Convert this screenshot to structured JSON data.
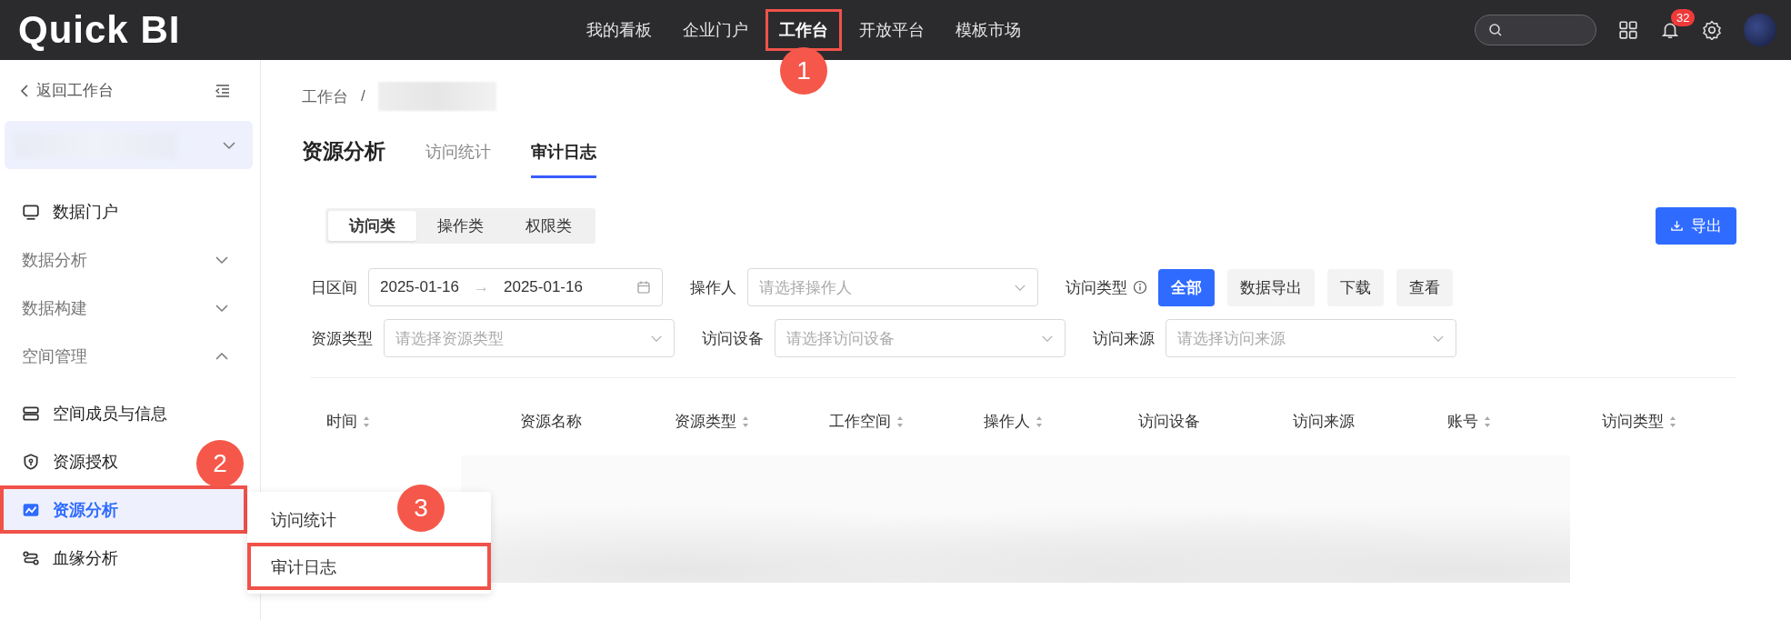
{
  "topbar": {
    "logo": "Quick BI",
    "nav": [
      {
        "label": "我的看板",
        "selected": false,
        "highlighted": false
      },
      {
        "label": "企业门户",
        "selected": false,
        "highlighted": false
      },
      {
        "label": "工作台",
        "selected": true,
        "highlighted": true,
        "callout": "1"
      },
      {
        "label": "开放平台",
        "selected": false,
        "highlighted": false
      },
      {
        "label": "模板市场",
        "selected": false,
        "highlighted": false
      }
    ],
    "notification_count": "32"
  },
  "sidebar": {
    "back": "返回工作台",
    "items": [
      {
        "kind": "link",
        "label": "数据门户",
        "selected": false
      },
      {
        "kind": "group",
        "label": "数据分析",
        "expanded": false
      },
      {
        "kind": "group",
        "label": "数据构建",
        "expanded": false
      },
      {
        "kind": "group",
        "label": "空间管理",
        "expanded": true,
        "children": [
          {
            "label": "空间成员与信息",
            "selected": false,
            "highlighted": false
          },
          {
            "label": "资源授权",
            "selected": false,
            "highlighted": false
          },
          {
            "label": "资源分析",
            "selected": true,
            "highlighted": true,
            "callout": "2"
          },
          {
            "label": "血缘分析",
            "selected": false,
            "highlighted": false
          }
        ]
      }
    ]
  },
  "popup_menu": {
    "items": [
      {
        "label": "访问统计",
        "highlighted": false
      },
      {
        "label": "审计日志",
        "highlighted": true,
        "callout": "3"
      }
    ]
  },
  "breadcrumb": {
    "root": "工作台",
    "separator": "/"
  },
  "page": {
    "title": "资源分析",
    "tabs": [
      {
        "label": "访问统计",
        "selected": false
      },
      {
        "label": "审计日志",
        "selected": true
      }
    ]
  },
  "segments": [
    {
      "label": "访问类",
      "selected": true
    },
    {
      "label": "操作类",
      "selected": false
    },
    {
      "label": "权限类",
      "selected": false
    }
  ],
  "export_button": "导出",
  "filters": [
    [
      {
        "kind": "date",
        "label": "日区间",
        "start": "2025-01-16",
        "separator": "→",
        "end": "2025-01-16"
      },
      {
        "kind": "select",
        "label": "操作人",
        "placeholder": "请选择操作人"
      },
      {
        "kind": "chips",
        "label": "访问类型",
        "options": [
          {
            "label": "全部",
            "selected": true
          },
          {
            "label": "数据导出",
            "selected": false
          },
          {
            "label": "下载",
            "selected": false
          },
          {
            "label": "查看",
            "selected": false
          }
        ]
      }
    ],
    [
      {
        "kind": "select",
        "label": "资源类型",
        "placeholder": "请选择资源类型"
      },
      {
        "kind": "select",
        "label": "访问设备",
        "placeholder": "请选择访问设备"
      },
      {
        "kind": "select",
        "label": "访问来源",
        "placeholder": "请选择访问来源"
      }
    ]
  ],
  "table": {
    "columns": [
      {
        "label": "时间",
        "sortable": true
      },
      {
        "label": "资源名称",
        "sortable": false
      },
      {
        "label": "资源类型",
        "sortable": true
      },
      {
        "label": "工作空间",
        "sortable": true
      },
      {
        "label": "操作人",
        "sortable": true
      },
      {
        "label": "访问设备",
        "sortable": false
      },
      {
        "label": "访问来源",
        "sortable": false
      },
      {
        "label": "账号",
        "sortable": true
      },
      {
        "label": "访问类型",
        "sortable": true
      }
    ]
  }
}
